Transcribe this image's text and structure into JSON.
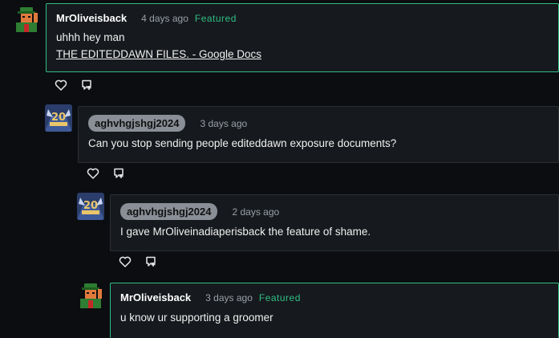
{
  "comments": [
    {
      "author": "MrOliveisback",
      "time": "4 days ago",
      "featured_label": "Featured",
      "body": "uhhh hey man",
      "link": "THE EDITEDDAWN FILES. - Google Docs"
    },
    {
      "author": "aghvhgjshgj2024",
      "time": "3 days ago",
      "body": "Can you stop sending people editeddawn exposure documents?"
    },
    {
      "author": "aghvhgjshgj2024",
      "time": "2 days ago",
      "body": "I gave MrOliveinadiaperisback the feature of shame."
    },
    {
      "author": "MrOliveisback",
      "time": "3 days ago",
      "featured_label": "Featured",
      "body": "u know ur supporting a groomer"
    }
  ],
  "icons": {
    "like": "heart-icon",
    "reply": "reply-icon",
    "avatar_1": "soldier-avatar",
    "avatar_2": "20th-century-logo-avatar"
  },
  "colors": {
    "background": "#0b0d10",
    "card": "#16191d",
    "featured_accent": "#2fbf83"
  }
}
